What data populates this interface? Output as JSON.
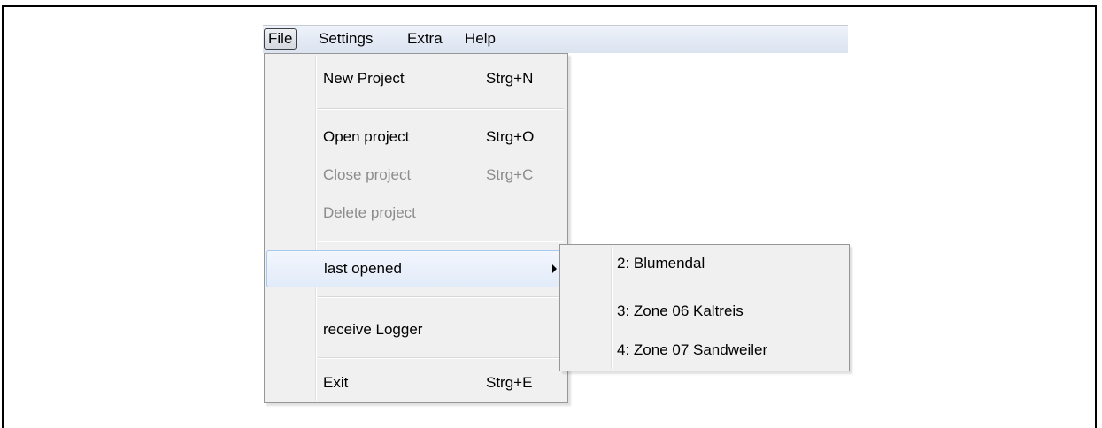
{
  "menubar": {
    "items": [
      {
        "label": "File"
      },
      {
        "label": "Settings"
      },
      {
        "label": "Extra"
      },
      {
        "label": "Help"
      }
    ]
  },
  "file_menu": {
    "new_project": {
      "label": "New Project",
      "shortcut": "Strg+N"
    },
    "open_project": {
      "label": "Open project",
      "shortcut": "Strg+O"
    },
    "close_project": {
      "label": "Close project",
      "shortcut": "Strg+C"
    },
    "delete_project": {
      "label": "Delete project"
    },
    "last_opened": {
      "label": "last opened"
    },
    "receive_logger": {
      "label": "receive Logger"
    },
    "exit": {
      "label": "Exit",
      "shortcut": "Strg+E"
    }
  },
  "last_opened_submenu": {
    "items": [
      {
        "label": "2: Blumendal"
      },
      {
        "label": "3: Zone 06 Kaltreis"
      },
      {
        "label": "4: Zone 07 Sandweiler"
      }
    ]
  }
}
